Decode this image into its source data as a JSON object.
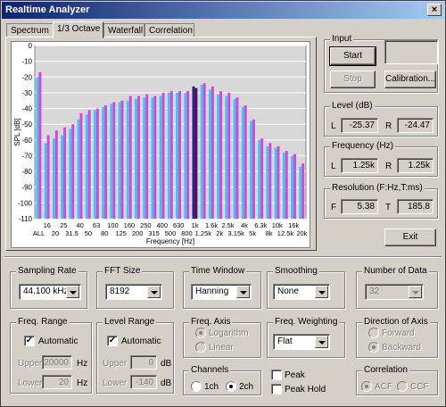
{
  "window": {
    "title": "Realtime Analyzer",
    "close_glyph": "×"
  },
  "tabs": [
    {
      "label": "Spectrum"
    },
    {
      "label": "1/3 Octave"
    },
    {
      "label": "Waterfall"
    },
    {
      "label": "Correlation"
    }
  ],
  "chart_data": {
    "type": "bar",
    "ylabel": "SPL [dB]",
    "xlabel": "Frequency [Hz]",
    "ylim": [
      -110,
      0
    ],
    "yticks": [
      0,
      -10,
      -20,
      -30,
      -40,
      -50,
      -60,
      -70,
      -80,
      -90,
      -100,
      -110
    ],
    "grid": true,
    "tick_labels_top": [
      "16",
      "25",
      "40",
      "63",
      "100",
      "160",
      "250",
      "400",
      "630",
      "1k",
      "1.6k",
      "2.5k",
      "4k",
      "6.3k",
      "10k",
      "16k"
    ],
    "tick_labels_bottom": [
      "ALL",
      "20",
      "31.5",
      "50",
      "80",
      "125",
      "200",
      "315",
      "500",
      "800",
      "1.25k",
      "2k",
      "3.15k",
      "5k",
      "8k",
      "12.5k",
      "20k"
    ],
    "categories": [
      "ALL",
      "16",
      "20",
      "25",
      "31.5",
      "40",
      "50",
      "63",
      "80",
      "100",
      "125",
      "160",
      "200",
      "250",
      "315",
      "400",
      "500",
      "630",
      "800",
      "1k",
      "1.25k",
      "1.6k",
      "2k",
      "2.5k",
      "3.15k",
      "4k",
      "5k",
      "6.3k",
      "8k",
      "10k",
      "12.5k",
      "16k",
      "20k"
    ],
    "series": [
      {
        "name": "L",
        "color": "#33ccee",
        "values": [
          -20,
          -62,
          -59,
          -57,
          -53,
          -47,
          -44,
          -41,
          -39,
          -37,
          -36,
          -35,
          -34,
          -33,
          -33,
          -32,
          -30,
          -30,
          -30,
          -26,
          -25,
          -28,
          -31,
          -32,
          -34,
          -39,
          -48,
          -60,
          -64,
          -65,
          -68,
          -70,
          -77
        ]
      },
      {
        "name": "R",
        "color": "#e040e0",
        "values": [
          -17,
          -57,
          -54,
          -52,
          -50,
          -43,
          -41,
          -40,
          -38,
          -36,
          -35,
          -32,
          -32,
          -31,
          -32,
          -30,
          -29,
          -29,
          -29,
          -27,
          -24,
          -26,
          -29,
          -30,
          -33,
          -38,
          -47,
          -59,
          -62,
          -64,
          -67,
          -69,
          -75
        ]
      }
    ],
    "highlight_category": "1k"
  },
  "input": {
    "label": "Input",
    "start_label": "Start",
    "stop_label": "Stop",
    "calibration_label": "Calibration..."
  },
  "level": {
    "label": "Level (dB)",
    "l_label": "L",
    "l_value": "-25.37",
    "r_label": "R",
    "r_value": "-24.47"
  },
  "frequency": {
    "label": "Frequency (Hz)",
    "l_label": "L",
    "l_value": "1.25k",
    "r_label": "R",
    "r_value": "1.25k"
  },
  "resolution": {
    "label": "Resolution (F:Hz,T:ms)",
    "f_label": "F",
    "f_value": "5.38",
    "t_label": "T",
    "t_value": "185.8"
  },
  "exit_label": "Exit",
  "sampling_rate": {
    "label": "Sampling Rate",
    "value": "44.100 kHz"
  },
  "fft_size": {
    "label": "FFT Size",
    "value": "8192"
  },
  "time_window": {
    "label": "Time Window",
    "value": "Hanning"
  },
  "smoothing": {
    "label": "Smoothing",
    "value": "None"
  },
  "number_of_data": {
    "label": "Number of Data",
    "value": "32"
  },
  "freq_range": {
    "label": "Freq. Range",
    "automatic_label": "Automatic",
    "check_glyph": "✓",
    "upper_label": "Upper",
    "upper_value": "20000",
    "upper_unit": "Hz",
    "lower_label": "Lower",
    "lower_value": "20",
    "lower_unit": "Hz"
  },
  "level_range": {
    "label": "Level Range",
    "automatic_label": "Automatic",
    "check_glyph": "✓",
    "upper_label": "Upper",
    "upper_value": "0",
    "upper_unit": "dB",
    "lower_label": "Lower",
    "lower_value": "-140",
    "lower_unit": "dB"
  },
  "freq_axis": {
    "label": "Freq. Axis",
    "logarithm_label": "Logarithm",
    "linear_label": "Linear"
  },
  "freq_weighting": {
    "label": "Freq. Weighting",
    "value": "Flat"
  },
  "direction_of_axis": {
    "label": "Direction of Axis",
    "forward_label": "Forward",
    "backward_label": "Backward"
  },
  "channels": {
    "label": "Channels",
    "ch1_label": "1ch",
    "ch2_label": "2ch"
  },
  "peak": {
    "peak_label": "Peak",
    "peak_hold_label": "Peak Hold"
  },
  "correlation": {
    "label": "Correlation",
    "acf_label": "ACF",
    "ccf_label": "CCF"
  }
}
